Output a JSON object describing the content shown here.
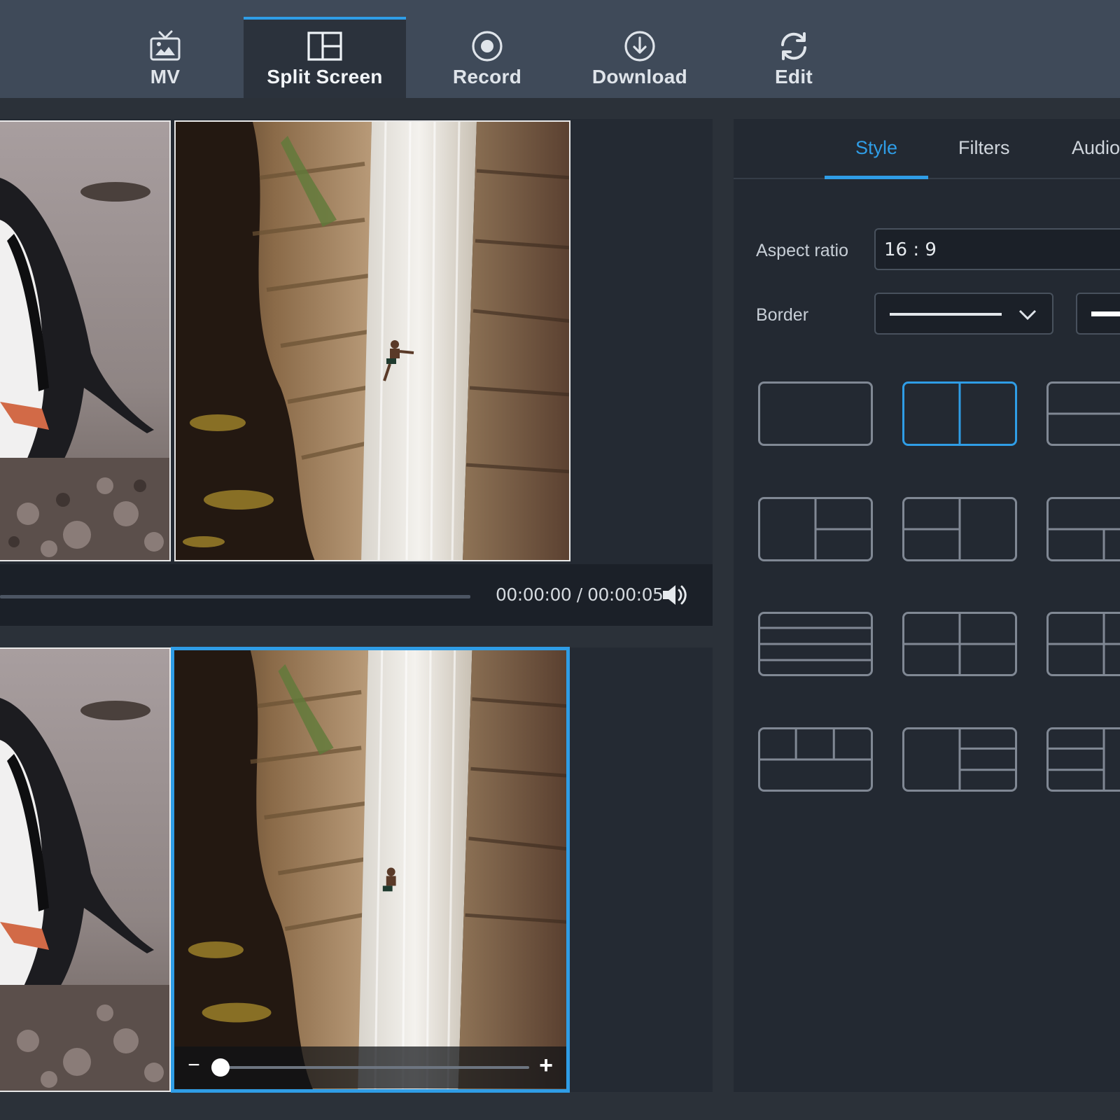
{
  "toolbar": {
    "items": [
      {
        "label": "MV",
        "icon": "tv-icon"
      },
      {
        "label": "Split Screen",
        "icon": "split-screen-icon",
        "active": true
      },
      {
        "label": "Record",
        "icon": "record-icon"
      },
      {
        "label": "Download",
        "icon": "download-icon"
      },
      {
        "label": "Edit",
        "icon": "refresh-icon"
      }
    ]
  },
  "player": {
    "timecode": "00:00:00 / 00:00:05",
    "progress": 0
  },
  "panel": {
    "tabs": [
      "Style",
      "Filters",
      "Audio"
    ],
    "active_tab": "Style",
    "aspect_ratio_label": "Aspect ratio",
    "aspect_ratio_value": "16 : 9",
    "border_label": "Border",
    "selected_layout": "layout-2-vertical"
  },
  "colors": {
    "accent": "#2f9de6",
    "toolbar_bg": "#3f4a59",
    "panel_bg": "#232932"
  }
}
